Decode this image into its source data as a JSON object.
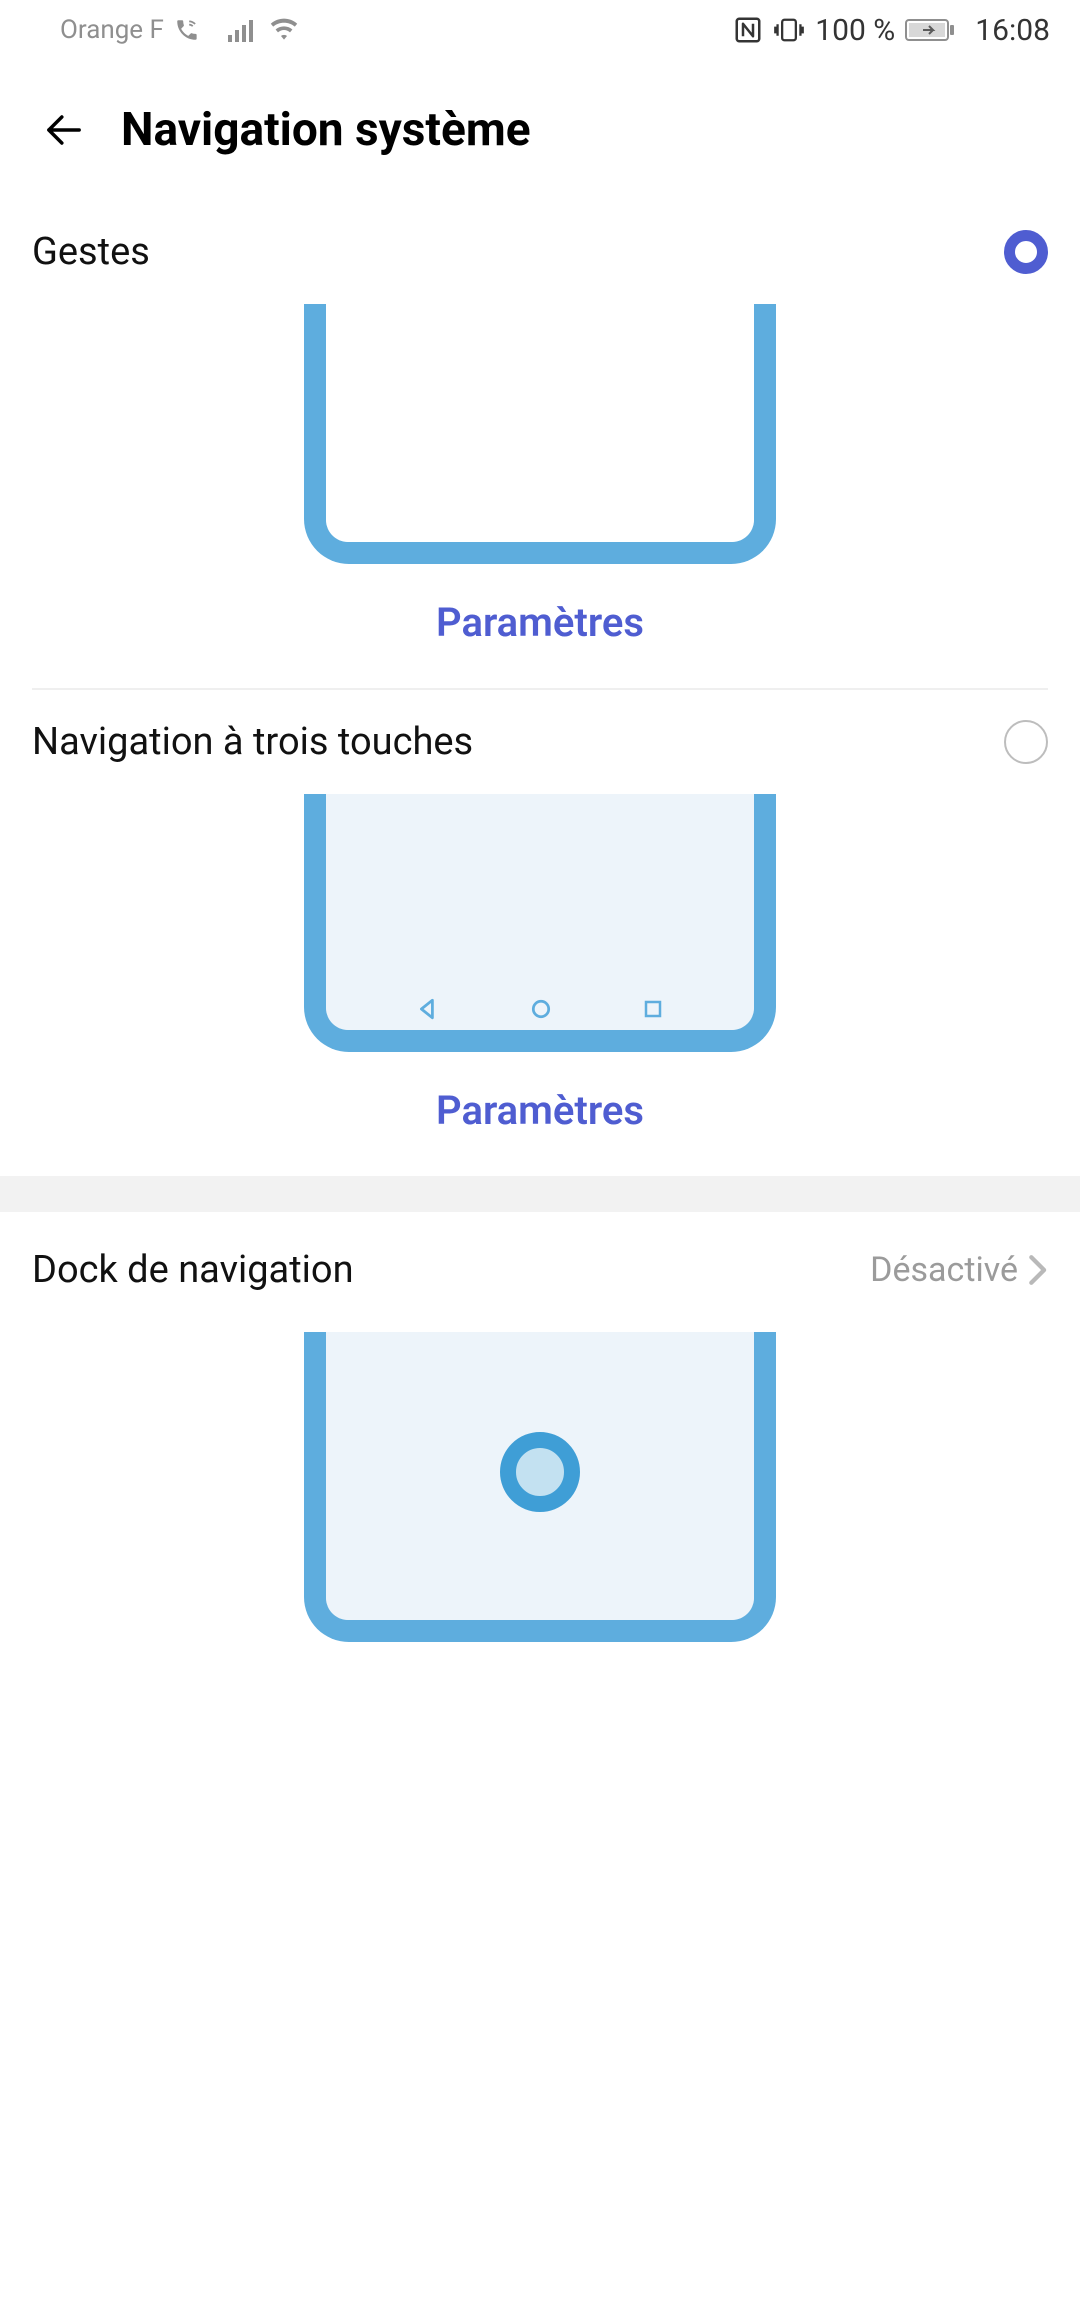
{
  "status": {
    "carrier": "Orange F",
    "battery_pct": "100 %",
    "time": "16:08"
  },
  "header": {
    "title": "Navigation système"
  },
  "options": {
    "gestures": {
      "label": "Gestes",
      "settings_label": "Paramètres"
    },
    "three_key": {
      "label": "Navigation à trois touches",
      "settings_label": "Paramètres"
    },
    "dock": {
      "label": "Dock de navigation",
      "value": "Désactivé"
    }
  }
}
